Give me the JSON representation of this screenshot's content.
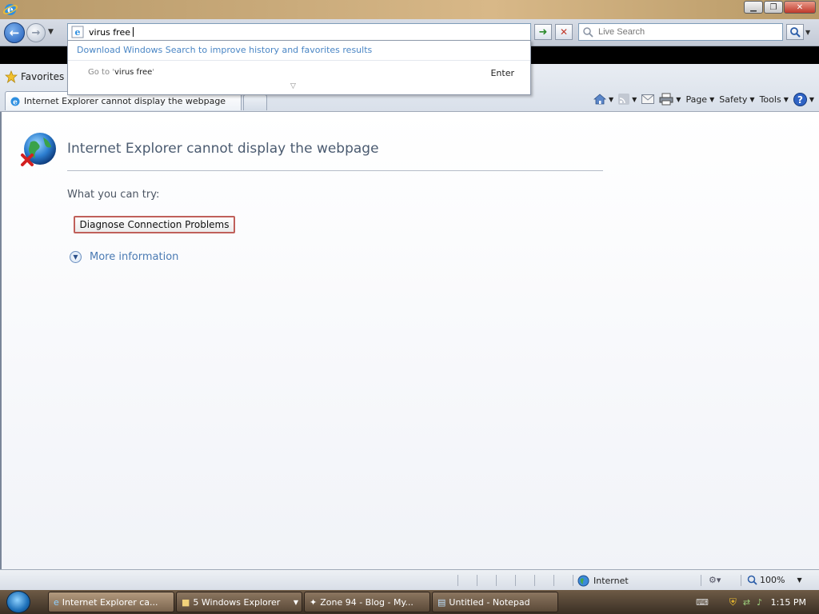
{
  "window": {
    "app_icon": "ie-icon",
    "min_label": "▁",
    "restore_label": "❐",
    "close_label": "✕"
  },
  "nav": {
    "back_icon": "back-arrow-icon",
    "forward_icon": "forward-arrow-icon",
    "address_value": "virus free",
    "search_placeholder": "Live Search"
  },
  "dropdown": {
    "download_text": "Download Windows Search to improve history and favorites results",
    "goto_prefix": "Go to '",
    "goto_value": "virus free",
    "goto_suffix": "'",
    "enter_label": "Enter"
  },
  "favbar": {
    "favorites_label": "Favorites",
    "tab_title": "Internet Explorer cannot display the webpage",
    "page_label": "Page",
    "safety_label": "Safety",
    "tools_label": "Tools"
  },
  "content": {
    "title": "Internet Explorer cannot display the webpage",
    "try_text": "What you can try:",
    "diagnose_label": "Diagnose Connection Problems",
    "more_info_label": "More information"
  },
  "statusbar": {
    "zone_label": "Internet",
    "zoom_label": "100%"
  },
  "taskbar": {
    "items": [
      {
        "label": "Internet Explorer ca...",
        "active": true
      },
      {
        "label": "5 Windows Explorer"
      },
      {
        "label": "Zone 94 - Blog - My..."
      },
      {
        "label": "Untitled - Notepad"
      }
    ],
    "clock": "1:15 PM"
  },
  "colors": {
    "accent_blue": "#4a86c5",
    "title_text": "#4b5b70",
    "diagnose_border": "#c0605a"
  }
}
